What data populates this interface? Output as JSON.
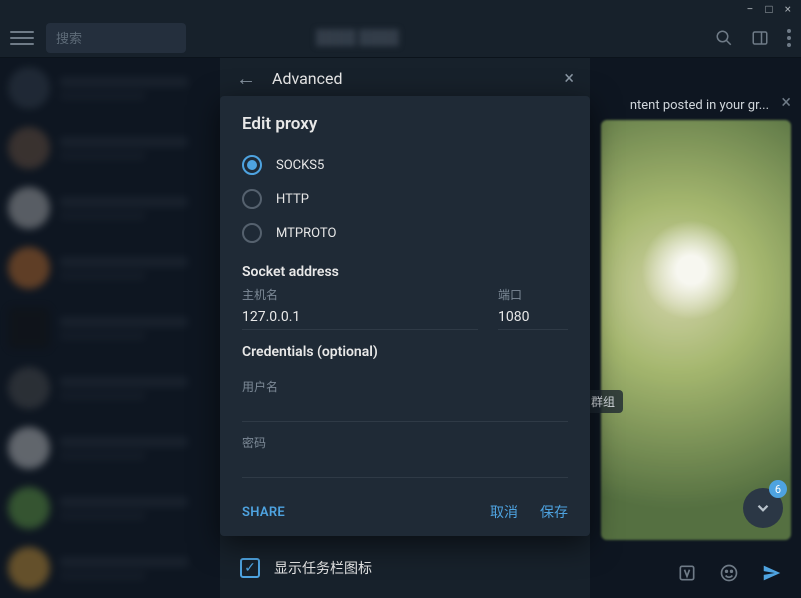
{
  "titlebar": {
    "min": "−",
    "max": "□",
    "close": "×"
  },
  "search": {
    "placeholder": "搜索"
  },
  "adv": {
    "title": "Advanced",
    "taskbar_label": "显示任务栏图标"
  },
  "modal": {
    "title": "Edit proxy",
    "radios": {
      "socks5": "SOCKS5",
      "http": "HTTP",
      "mtproto": "MTPROTO"
    },
    "socket_title": "Socket address",
    "host_label": "主机名",
    "host_value": "127.0.0.1",
    "port_label": "端口",
    "port_value": "1080",
    "cred_title": "Credentials (optional)",
    "user_label": "用户名",
    "pass_label": "密码",
    "share": "SHARE",
    "cancel": "取消",
    "save": "保存"
  },
  "notice": "ntent posted in your gr...",
  "badge": "6",
  "tag": "群组"
}
